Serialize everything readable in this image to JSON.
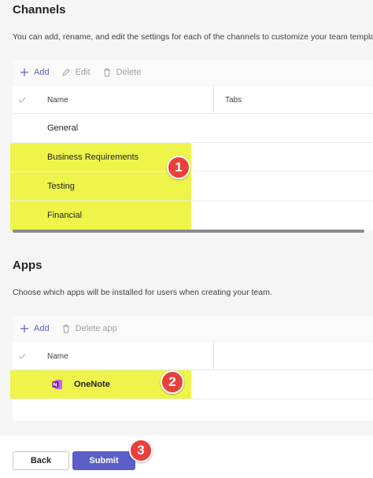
{
  "channels": {
    "title": "Channels",
    "description": "You can add, rename, and edit the settings for each of the channels to customize your team template",
    "toolbar": {
      "add": "Add",
      "edit": "Edit",
      "delete": "Delete"
    },
    "columns": {
      "name": "Name",
      "tabs": "Tabs"
    },
    "rows": [
      "General",
      "Business Requirements",
      "Testing",
      "Financial"
    ]
  },
  "apps": {
    "title": "Apps",
    "description": "Choose which apps will be installed for users when creating your team.",
    "toolbar": {
      "add": "Add",
      "delete": "Delete app"
    },
    "columns": {
      "name": "Name"
    },
    "rows": [
      "OneNote"
    ]
  },
  "badges": [
    "1",
    "2",
    "3"
  ],
  "footer": {
    "back": "Back",
    "submit": "Submit"
  },
  "colors": {
    "accent": "#5b5fc7",
    "highlight": "#eef44a",
    "badge": "#e8413b"
  }
}
